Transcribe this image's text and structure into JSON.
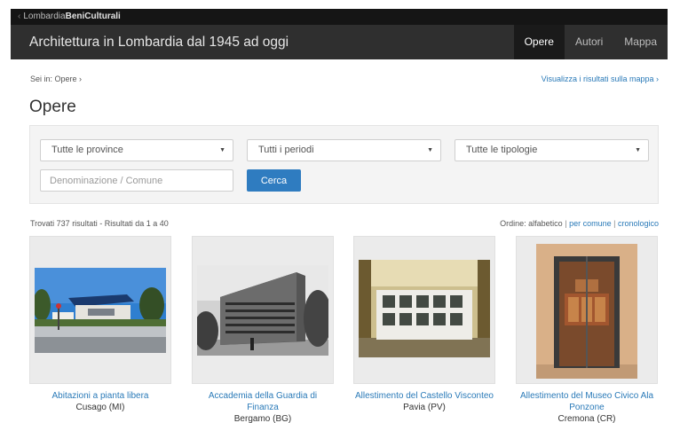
{
  "top_strip": {
    "back": "‹",
    "brand_light": "Lombardia",
    "brand_bold": "BeniCulturali"
  },
  "header": {
    "title": "Architettura in Lombardia dal 1945 ad oggi",
    "nav": [
      {
        "label": "Opere",
        "active": true
      },
      {
        "label": "Autori",
        "active": false
      },
      {
        "label": "Mappa",
        "active": false
      }
    ]
  },
  "breadcrumb": "Sei in: Opere ›",
  "map_link": "Visualizza i risultati sulla mappa ›",
  "page_title": "Opere",
  "filters": {
    "province": "Tutte le province",
    "periodi": "Tutti i periodi",
    "tipologie": "Tutte le tipologie",
    "search_placeholder": "Denominazione / Comune",
    "search_button": "Cerca",
    "caret": "▼"
  },
  "results": {
    "count_text": "Trovati 737 risultati - Risultati da 1 a 40",
    "order_label": "Ordine: alfabetico",
    "order_sep": "|",
    "order_by_comune": "per comune",
    "order_cronologico": "cronologico"
  },
  "cards": [
    {
      "title": "Abitazioni a pianta libera",
      "place": "Cusago (MI)"
    },
    {
      "title": "Accademia della Guardia di Finanza",
      "place": "Bergamo (BG)"
    },
    {
      "title": "Allestimento del Castello Visconteo",
      "place": "Pavia (PV)"
    },
    {
      "title": "Allestimento del Museo Civico Ala Ponzone",
      "place": "Cremona (CR)"
    }
  ],
  "colors": {
    "link": "#2a7ab8",
    "button": "#2f7cc0",
    "navbar": "#2f2f2f",
    "nav_active": "#1a1a1a"
  }
}
